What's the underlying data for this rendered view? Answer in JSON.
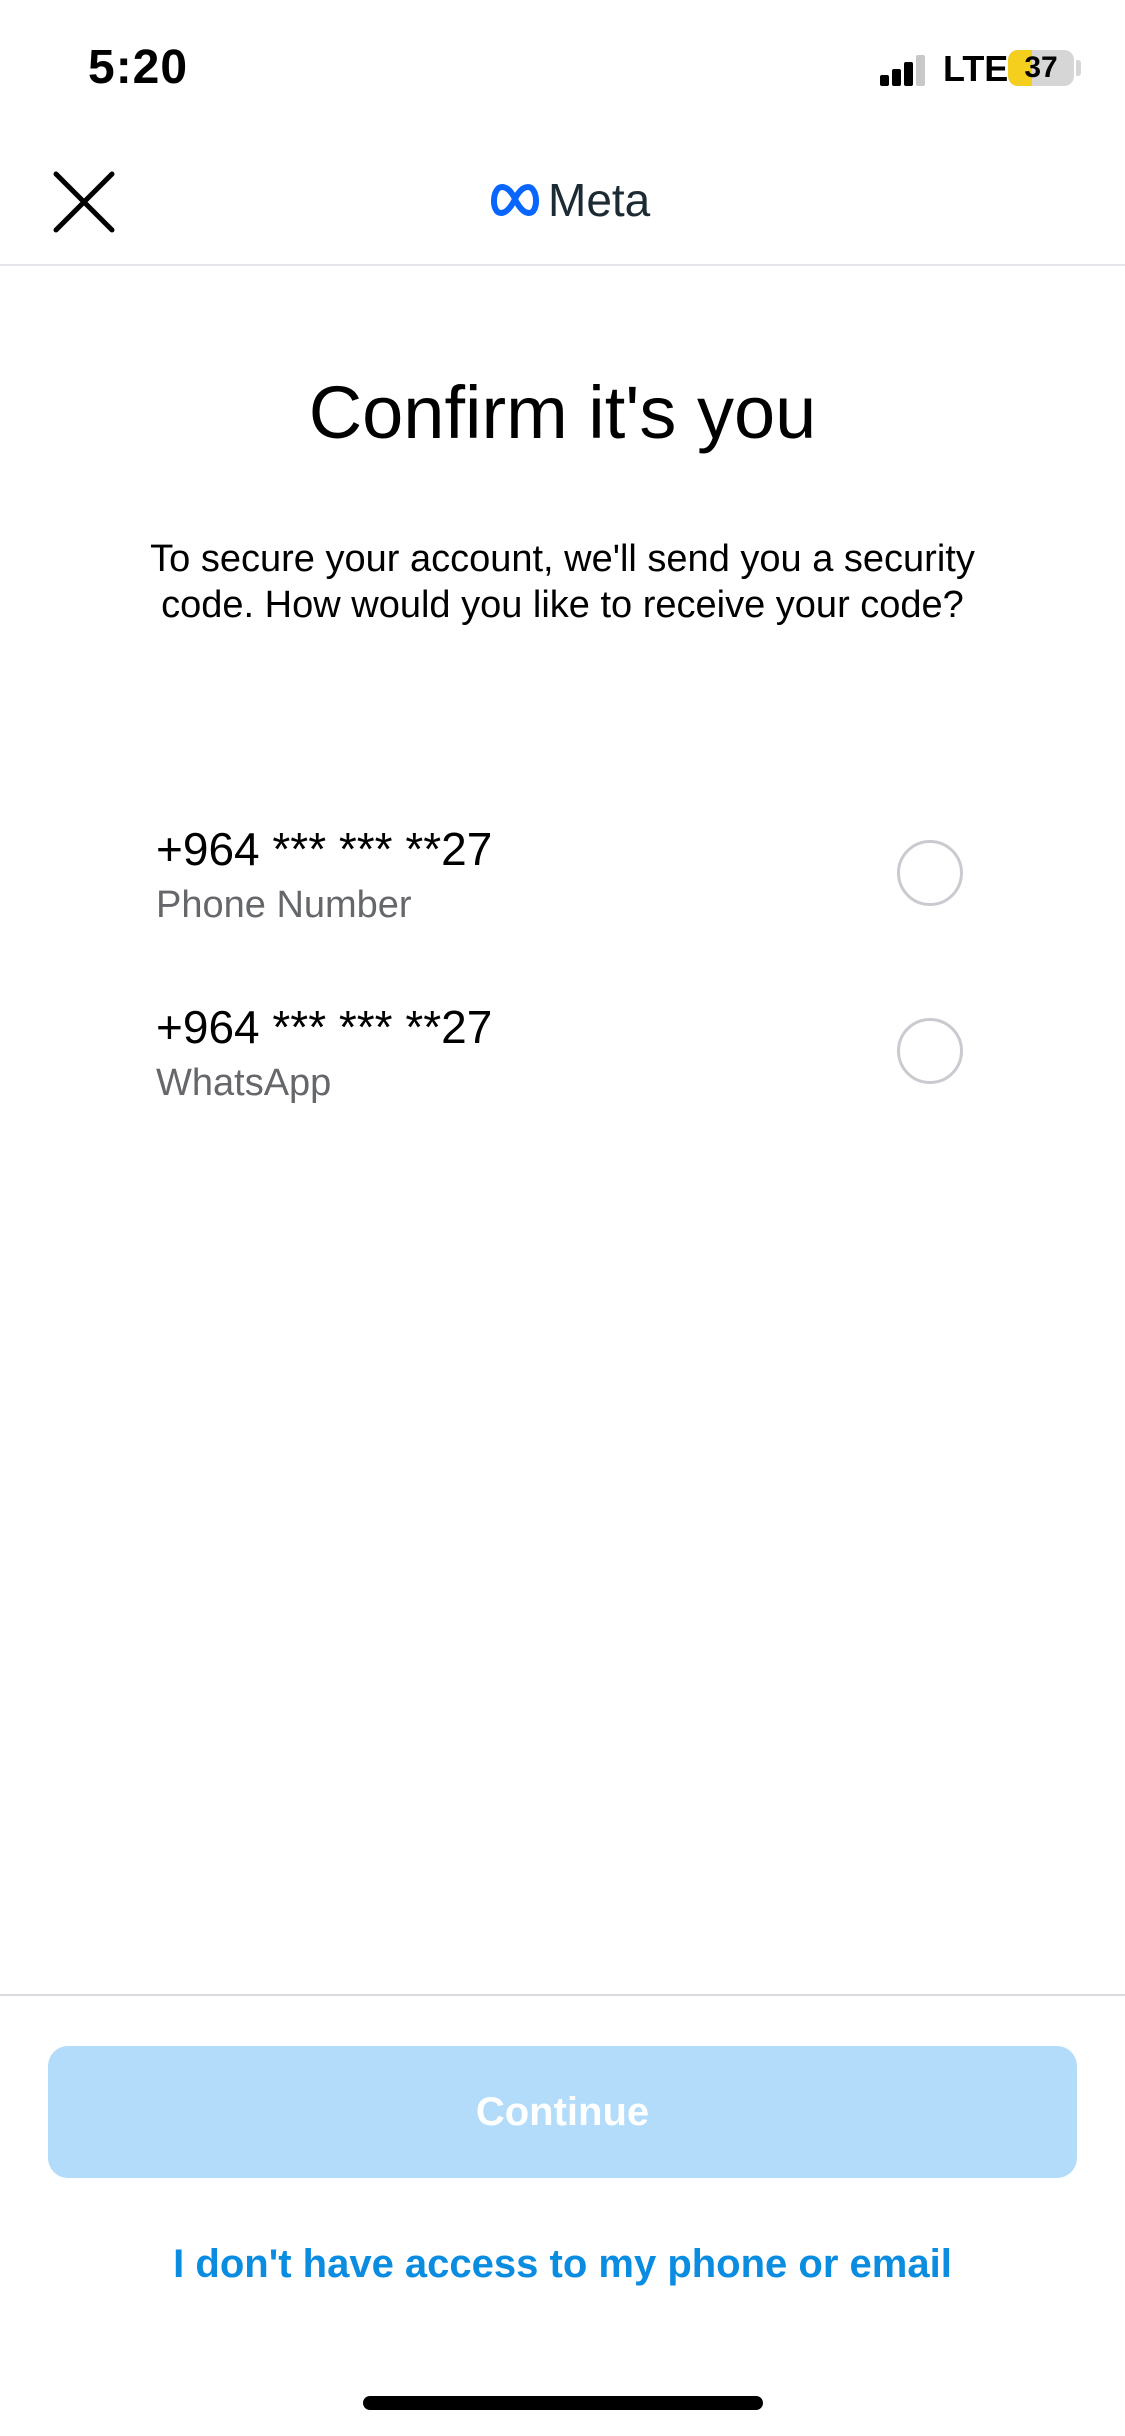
{
  "status_bar": {
    "time": "5:20",
    "network": "LTE",
    "battery_level": "37",
    "battery_fraction": 0.37,
    "battery_color": "#f5cf1d"
  },
  "header": {
    "brand_name": "Meta",
    "brand_color": "#0866ff",
    "close_icon": "close-icon"
  },
  "main": {
    "title": "Confirm it's you",
    "description": "To secure your account, we'll send you a security code. How would you like to receive your code?",
    "options": [
      {
        "number": "+964 *** *** **27",
        "label": "Phone Number",
        "selected": false
      },
      {
        "number": "+964 *** *** **27",
        "label": "WhatsApp",
        "selected": false
      }
    ]
  },
  "footer": {
    "continue_label": "Continue",
    "continue_color": "#b2dcfa",
    "no_access_label": "I don't have access to my phone or email",
    "link_color": "#0a8ce0"
  }
}
